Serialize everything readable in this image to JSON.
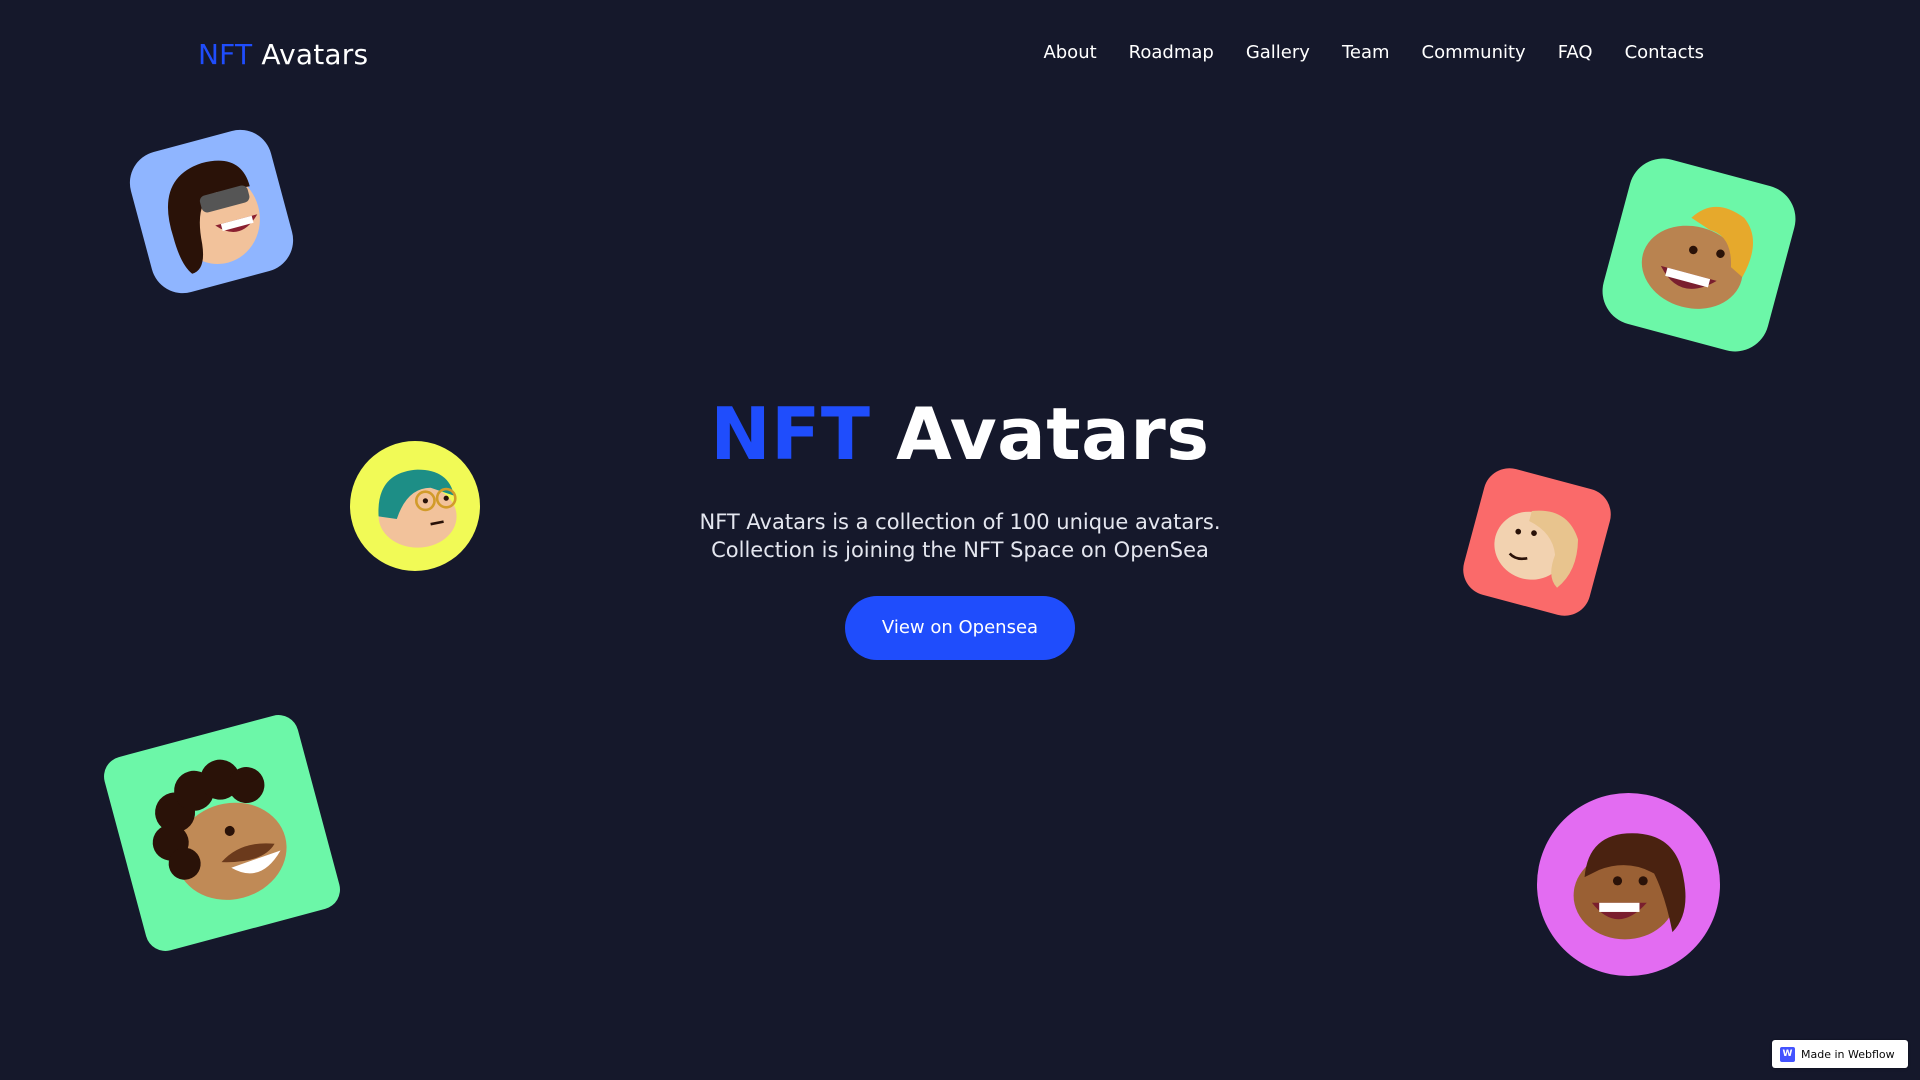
{
  "header": {
    "brand_accent": "NFT",
    "brand_rest": " Avatars",
    "nav": [
      {
        "label": "About"
      },
      {
        "label": "Roadmap"
      },
      {
        "label": "Gallery"
      },
      {
        "label": "Team"
      },
      {
        "label": "Community"
      },
      {
        "label": "FAQ"
      },
      {
        "label": "Contacts"
      }
    ]
  },
  "hero": {
    "title_accent": "NFT",
    "title_rest": " Avatars",
    "description_line1": "NFT Avatars is a collection of 100 unique avatars.",
    "description_line2": "Collection is joining the NFT Space on OpenSea",
    "cta_label": "View on Opensea"
  },
  "badge": {
    "label": "Made in Webflow",
    "icon": "webflow-icon"
  },
  "colors": {
    "background": "#15182b",
    "accent": "#1f4dfc",
    "text": "#ffffff",
    "avatar_blue": "#8fb5ff",
    "avatar_green": "#6cf7a8",
    "avatar_yellow": "#f1fa56",
    "avatar_red": "#fa6a6a",
    "avatar_pink": "#e36cf2"
  },
  "avatars": [
    {
      "icon": "avatar-girl-glasses-icon"
    },
    {
      "icon": "avatar-blond-boy-icon"
    },
    {
      "icon": "avatar-teal-hair-icon"
    },
    {
      "icon": "avatar-blond-girl-icon"
    },
    {
      "icon": "avatar-curly-mustache-icon"
    },
    {
      "icon": "avatar-dreadlocks-icon"
    }
  ]
}
